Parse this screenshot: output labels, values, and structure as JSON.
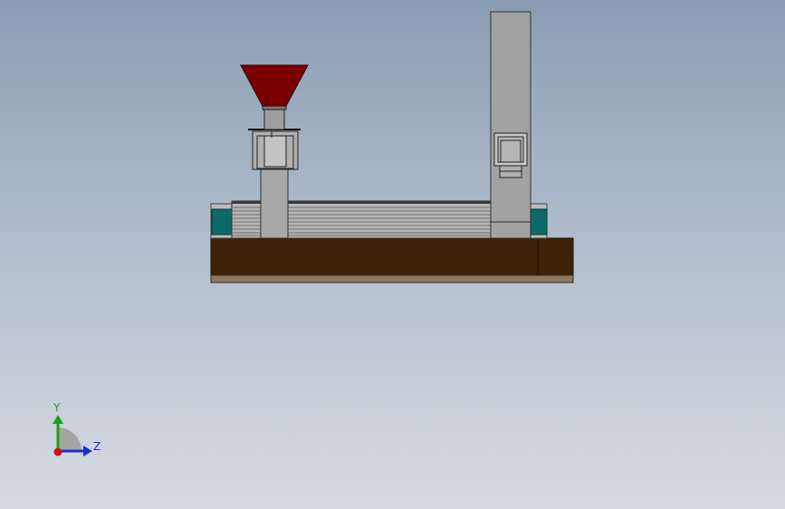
{
  "viewport": {
    "background_top": "#8a9db5",
    "background_bottom": "#d6dbe2"
  },
  "model": {
    "base_color": "#3e2208",
    "base_plate_color": "#8a7a60",
    "hopper_color": "#7a0000",
    "panel_color": "#0d6a6a",
    "body_color": "#a2a2a2"
  },
  "triad": {
    "y_label": "Y",
    "z_label": "Z",
    "y_color": "#1aa31a",
    "z_color": "#1a2fd0",
    "x_color": "#cc1111"
  }
}
